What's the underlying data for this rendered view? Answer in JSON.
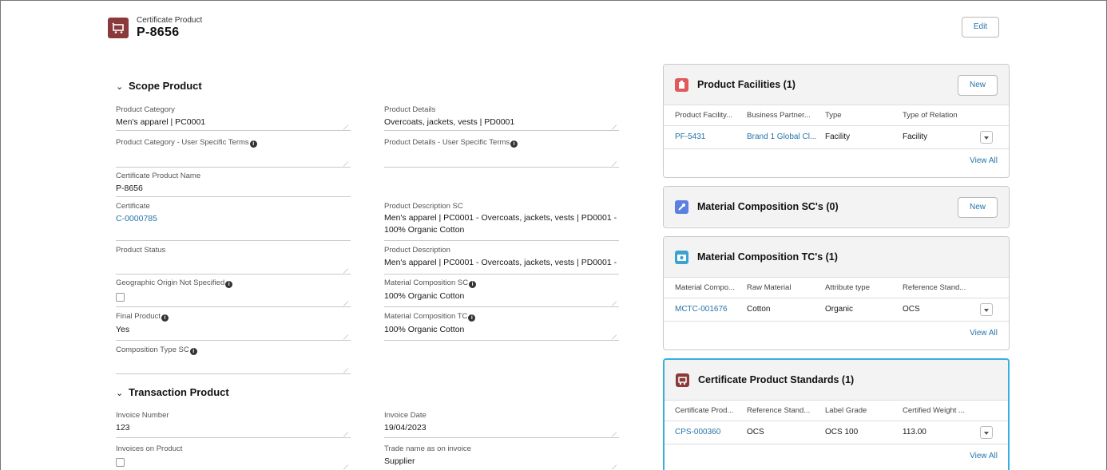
{
  "header": {
    "object_label": "Certificate Product",
    "record_title": "P-8656",
    "edit_label": "Edit",
    "icon": "cart-icon",
    "icon_color": "#8a3a3a"
  },
  "scope_section": {
    "title": "Scope Product",
    "fields": {
      "product_category": {
        "label": "Product Category",
        "value": "Men's apparel | PC0001"
      },
      "product_details": {
        "label": "Product Details",
        "value": "Overcoats, jackets, vests | PD0001"
      },
      "product_category_user": {
        "label": "Product Category - User Specific Terms",
        "value": ""
      },
      "product_details_user": {
        "label": "Product Details - User Specific Terms",
        "value": ""
      },
      "certificate_product_name": {
        "label": "Certificate Product Name",
        "value": "P-8656"
      },
      "certificate": {
        "label": "Certificate",
        "value": "C-0000785"
      },
      "product_description_sc": {
        "label": "Product Description SC",
        "value": "Men's apparel | PC0001 - Overcoats, jackets, vests | PD0001 - 100% Organic Cotton"
      },
      "product_status": {
        "label": "Product Status",
        "value": ""
      },
      "product_description": {
        "label": "Product Description",
        "value": "Men's apparel | PC0001 - Overcoats, jackets, vests | PD0001 -"
      },
      "geographic_origin": {
        "label": "Geographic Origin Not Specified",
        "checked": false
      },
      "material_composition_sc": {
        "label": "Material Composition SC",
        "value": "100% Organic Cotton"
      },
      "final_product": {
        "label": "Final Product",
        "value": "Yes"
      },
      "material_composition_tc": {
        "label": "Material Composition TC",
        "value": "100% Organic Cotton"
      },
      "composition_type_sc": {
        "label": "Composition Type SC",
        "value": ""
      }
    }
  },
  "transaction_section": {
    "title": "Transaction Product",
    "fields": {
      "invoice_number": {
        "label": "Invoice Number",
        "value": "123"
      },
      "invoice_date": {
        "label": "Invoice Date",
        "value": "19/04/2023"
      },
      "invoices_on_product": {
        "label": "Invoices on Product",
        "checked": false
      },
      "trade_name": {
        "label": "Trade name as on invoice",
        "value": "Supplier"
      }
    }
  },
  "related": {
    "facilities": {
      "title": "Product Facilities (1)",
      "new_label": "New",
      "icon_color": "#e05a5a",
      "columns": [
        "Product Facility...",
        "Business Partner...",
        "Type",
        "Type of Relation"
      ],
      "rows": [
        [
          "PF-5431",
          "Brand 1 Global Cl...",
          "Facility",
          "Facility"
        ]
      ],
      "view_all": "View All"
    },
    "material_sc": {
      "title": "Material Composition SC's (0)",
      "new_label": "New",
      "icon_color": "#5d7fe0"
    },
    "material_tc": {
      "title": "Material Composition TC's (1)",
      "icon_color": "#3aa3cf",
      "columns": [
        "Material Compo...",
        "Raw Material",
        "Attribute type",
        "Reference Stand..."
      ],
      "rows": [
        [
          "MCTC-001676",
          "Cotton",
          "Organic",
          "OCS"
        ]
      ],
      "view_all": "View All"
    },
    "standards": {
      "title": "Certificate Product Standards (1)",
      "icon_color": "#8a3a3a",
      "columns": [
        "Certificate Prod...",
        "Reference Stand...",
        "Label Grade",
        "Certified Weight ..."
      ],
      "rows": [
        [
          "CPS-000360",
          "OCS",
          "OCS 100",
          "113.00"
        ]
      ],
      "view_all": "View All"
    }
  }
}
